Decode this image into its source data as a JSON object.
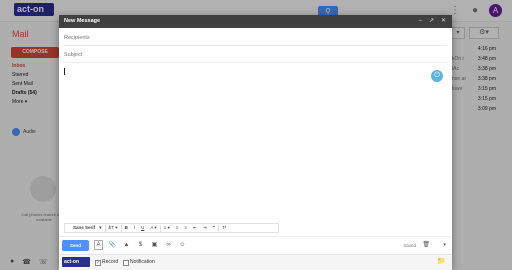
{
  "background": {
    "logo": "act-on",
    "mail_title": "Mail",
    "compose_label": "COMPOSE",
    "nav": [
      "Inbox",
      "Starred",
      "Sent Mail",
      "Drafts (54)",
      "More"
    ],
    "user_name": "Audie",
    "hangouts_text": "Call phones feature is not available",
    "avatar_letter": "A",
    "right_rows": [
      {
        "frag": "",
        "time": "4:16 pm"
      },
      {
        "frag": "kOn i",
        "time": "3:48 pm"
      },
      {
        "frag": "iAc",
        "time": "3:38 pm"
      },
      {
        "frag": "nse as",
        "time": "3:38 pm"
      },
      {
        "frag": "lowe",
        "time": "3:15 pm"
      },
      {
        "frag": "",
        "time": "3:15 pm"
      },
      {
        "frag": "",
        "time": "3:09 pm"
      }
    ]
  },
  "dialog": {
    "title": "New Message",
    "recipients_placeholder": "Recipients",
    "subject_placeholder": "Subject",
    "font_name": "Sans Serif",
    "send_label": "Send",
    "saved_label": "Saved",
    "acton_logo": "act-on",
    "record_label": "Record",
    "notification_label": "Notification",
    "record_checked": true,
    "notification_checked": false
  }
}
